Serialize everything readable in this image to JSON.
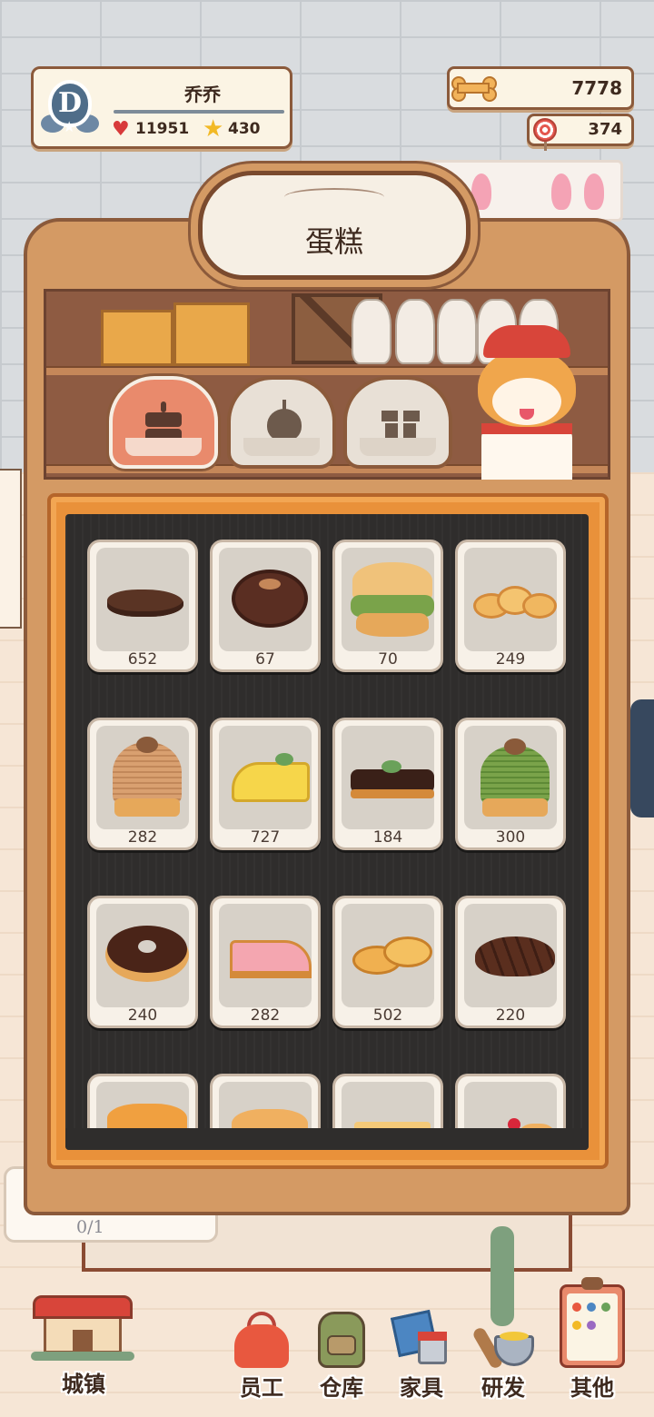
{
  "player": {
    "rank_letter": "D",
    "name": "乔乔",
    "hearts": "11951",
    "stars": "430"
  },
  "currency": {
    "bones": "7778",
    "candy": "374"
  },
  "panel": {
    "title": "蛋糕",
    "tabs": [
      {
        "name": "cake",
        "icon": "cake-icon",
        "active": true
      },
      {
        "name": "fruit",
        "icon": "apple-icon",
        "active": false
      },
      {
        "name": "gift",
        "icon": "gift-icon",
        "active": false
      }
    ]
  },
  "items": [
    {
      "icon": "chocolate-cookie-icon",
      "qty": "652"
    },
    {
      "icon": "chocolate-bun-icon",
      "qty": "67"
    },
    {
      "icon": "matcha-cream-puff-icon",
      "qty": "70"
    },
    {
      "icon": "butter-cookie-icon",
      "qty": "249"
    },
    {
      "icon": "chestnut-mont-blanc-icon",
      "qty": "282"
    },
    {
      "icon": "lemon-cake-slice-icon",
      "qty": "727"
    },
    {
      "icon": "chocolate-tart-slice-icon",
      "qty": "184"
    },
    {
      "icon": "matcha-mont-blanc-icon",
      "qty": "300"
    },
    {
      "icon": "sprinkle-donut-icon",
      "qty": "240"
    },
    {
      "icon": "strawberry-cake-slice-icon",
      "qty": "282"
    },
    {
      "icon": "biscuit-icon",
      "qty": "502"
    },
    {
      "icon": "chocolate-croissant-icon",
      "qty": "220"
    },
    {
      "icon": "orange-tart-icon",
      "qty": ""
    },
    {
      "icon": "puff-pastry-icon",
      "qty": ""
    },
    {
      "icon": "cheesecake-slice-icon",
      "qty": ""
    },
    {
      "icon": "cherry-cake-icon",
      "qty": ""
    }
  ],
  "background": {
    "stall_counter": "0/1"
  },
  "nav": {
    "town": "城镇",
    "staff": "员工",
    "storage": "仓库",
    "furniture": "家具",
    "research": "研发",
    "other": "其他"
  },
  "colors": {
    "panel_wood": "#d49a64",
    "board_orange": "#e9913a",
    "board_dark": "#2f2d2c",
    "active_tab": "#e98a6c",
    "text_dark": "#3e2a1f"
  }
}
